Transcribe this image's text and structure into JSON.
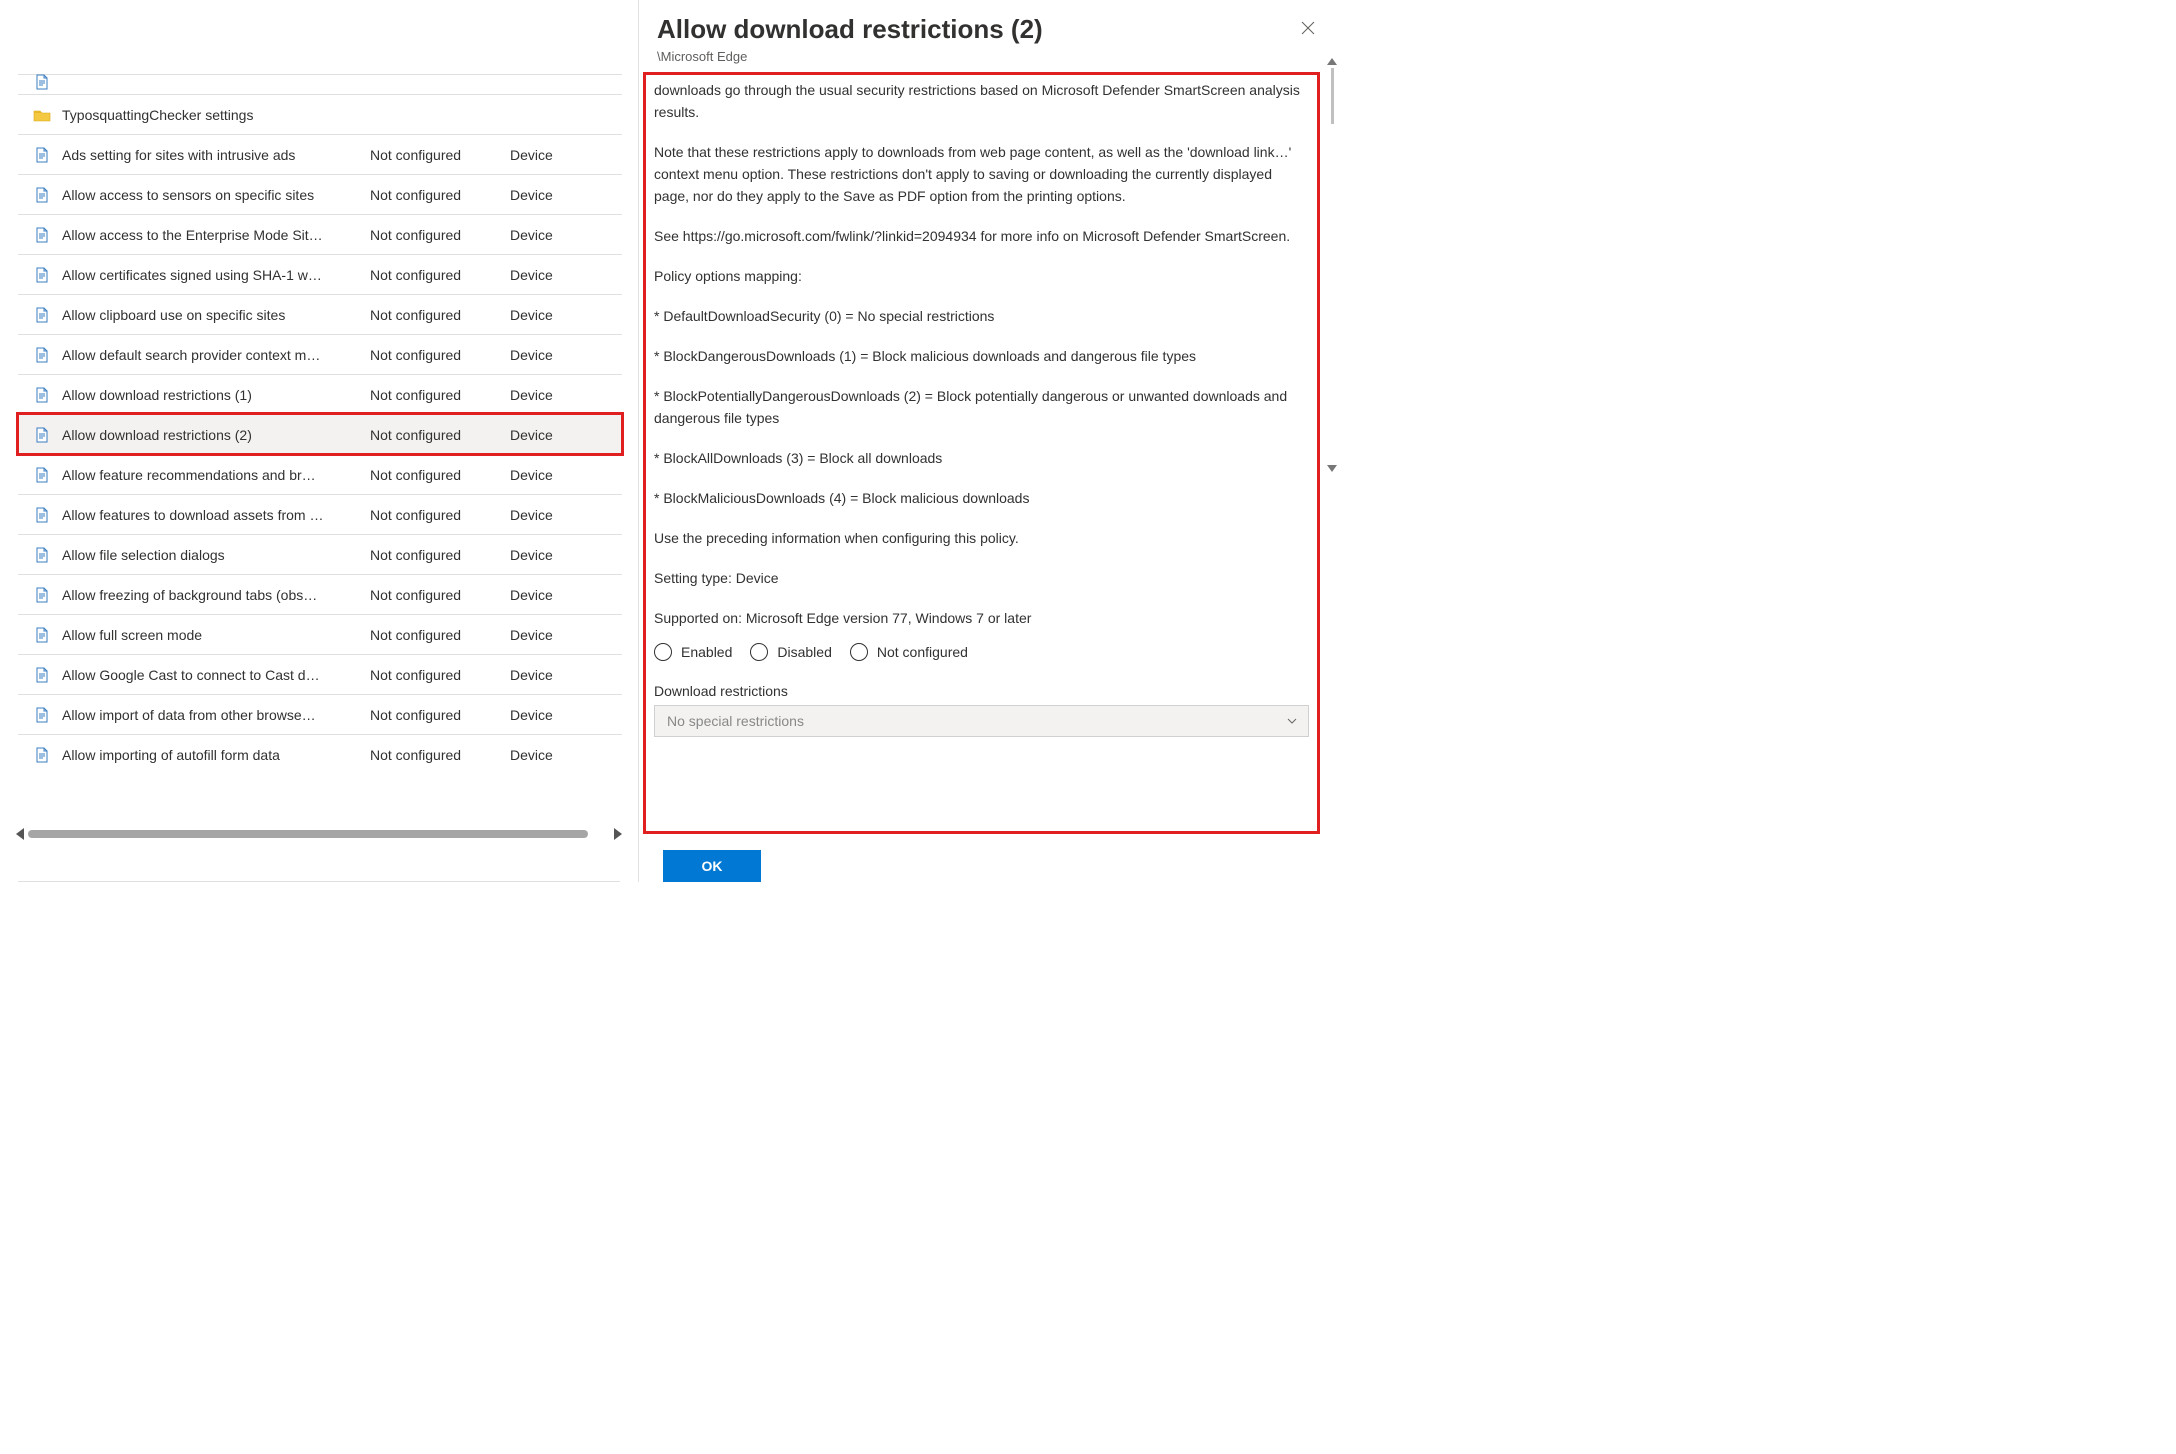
{
  "left": {
    "folder_row": {
      "label": "TyposquattingChecker settings"
    },
    "setting_rows": [
      {
        "name": "Ads setting for sites with intrusive ads",
        "state": "Not configured",
        "scope": "Device"
      },
      {
        "name": "Allow access to sensors on specific sites",
        "state": "Not configured",
        "scope": "Device"
      },
      {
        "name": "Allow access to the Enterprise Mode Sit…",
        "state": "Not configured",
        "scope": "Device"
      },
      {
        "name": "Allow certificates signed using SHA-1 w…",
        "state": "Not configured",
        "scope": "Device"
      },
      {
        "name": "Allow clipboard use on specific sites",
        "state": "Not configured",
        "scope": "Device"
      },
      {
        "name": "Allow default search provider context m…",
        "state": "Not configured",
        "scope": "Device"
      },
      {
        "name": "Allow download restrictions (1)",
        "state": "Not configured",
        "scope": "Device"
      },
      {
        "name": "Allow download restrictions (2)",
        "state": "Not configured",
        "scope": "Device",
        "selected": true,
        "highlighted": true
      },
      {
        "name": "Allow feature recommendations and br…",
        "state": "Not configured",
        "scope": "Device"
      },
      {
        "name": "Allow features to download assets from …",
        "state": "Not configured",
        "scope": "Device"
      },
      {
        "name": "Allow file selection dialogs",
        "state": "Not configured",
        "scope": "Device"
      },
      {
        "name": "Allow freezing of background tabs (obs…",
        "state": "Not configured",
        "scope": "Device"
      },
      {
        "name": "Allow full screen mode",
        "state": "Not configured",
        "scope": "Device"
      },
      {
        "name": "Allow Google Cast to connect to Cast d…",
        "state": "Not configured",
        "scope": "Device"
      },
      {
        "name": "Allow import of data from other browse…",
        "state": "Not configured",
        "scope": "Device"
      },
      {
        "name": "Allow importing of autofill form data",
        "state": "Not configured",
        "scope": "Device"
      }
    ]
  },
  "blade": {
    "title": "Allow download restrictions (2)",
    "subtitle": "\\Microsoft Edge",
    "paragraphs": [
      "downloads go through the usual security restrictions based on Microsoft Defender SmartScreen analysis results.",
      "Note that these restrictions apply to downloads from web page content, as well as the 'download link…' context menu option. These restrictions don't apply to saving or downloading the currently displayed page, nor do they apply to the Save as PDF option from the printing options.",
      "See https://go.microsoft.com/fwlink/?linkid=2094934 for more info on Microsoft Defender SmartScreen.",
      "Policy options mapping:",
      "* DefaultDownloadSecurity (0) = No special restrictions",
      "* BlockDangerousDownloads (1) = Block malicious downloads and dangerous file types",
      "* BlockPotentiallyDangerousDownloads (2) = Block potentially dangerous or unwanted downloads and dangerous file types",
      "* BlockAllDownloads (3) = Block all downloads",
      "* BlockMaliciousDownloads (4) = Block malicious downloads",
      "Use the preceding information when configuring this policy.",
      "Setting type: Device",
      "Supported on: Microsoft Edge version 77, Windows 7 or later"
    ],
    "radios": {
      "enabled": "Enabled",
      "disabled": "Disabled",
      "not_configured": "Not configured"
    },
    "field_label": "Download restrictions",
    "select_placeholder": "No special restrictions",
    "ok_label": "OK"
  }
}
